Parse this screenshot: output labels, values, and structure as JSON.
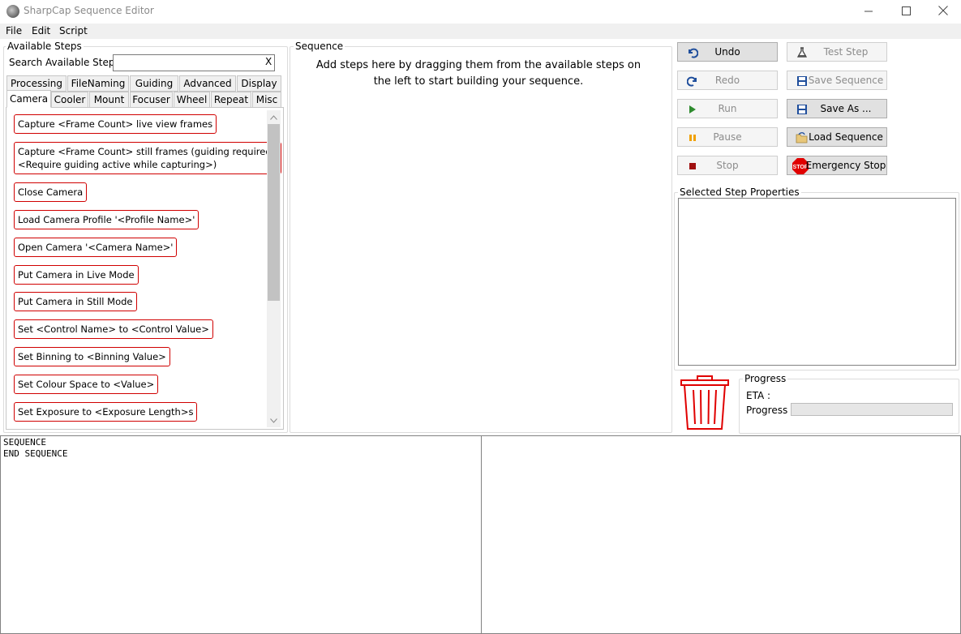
{
  "window": {
    "title": "SharpCap Sequence Editor",
    "minimize_glyph": "—",
    "maximize_glyph": "☐",
    "close_glyph": "✕"
  },
  "menu": [
    "File",
    "Edit",
    "Script"
  ],
  "available_steps": {
    "title": "Available Steps",
    "search_label": "Search Available Steps",
    "search_value": "",
    "search_clear": "X",
    "tabs_row1": [
      "Processing",
      "FileNaming",
      "Guiding",
      "Advanced",
      "Display"
    ],
    "tabs_row2": [
      "Camera",
      "Cooler",
      "Mount",
      "Focuser",
      "Wheel",
      "Repeat",
      "Misc"
    ],
    "active_tab": "Camera",
    "steps": [
      "Capture <Frame Count> live view frames",
      "Capture <Frame Count> still frames (guiding required :\n<Require guiding active while capturing>)",
      "Close Camera",
      "Load Camera Profile '<Profile Name>'",
      "Open Camera '<Camera Name>'",
      "Put Camera in Live Mode",
      "Put Camera in Still Mode",
      "Set <Control Name> to <Control Value>",
      "Set Binning to <Binning Value>",
      "Set Colour Space to <Value>",
      "Set Exposure to <Exposure Length>s"
    ]
  },
  "sequence": {
    "title": "Sequence",
    "hint_line1": "Add steps here by dragging them from the available steps on",
    "hint_line2": "the left to start building your sequence."
  },
  "buttons": {
    "undo": {
      "label": "Undo",
      "icon": "undo-icon"
    },
    "redo": {
      "label": "Redo",
      "icon": "redo-icon"
    },
    "run": {
      "label": "Run",
      "icon": "play-icon"
    },
    "pause": {
      "label": "Pause",
      "icon": "pause-icon"
    },
    "stop": {
      "label": "Stop",
      "icon": "stop-square-icon"
    },
    "test_step": {
      "label": "Test Step",
      "icon": "flask-icon"
    },
    "save_sequence": {
      "label": "Save Sequence",
      "icon": "floppy-icon"
    },
    "save_as": {
      "label": "Save As ...",
      "icon": "floppy-icon"
    },
    "load_sequence": {
      "label": "Load Sequence",
      "icon": "folder-open-icon"
    },
    "emergency_stop": {
      "label": "Emergency Stop",
      "icon": "stop-sign-icon",
      "icon_text": "STOP"
    }
  },
  "properties": {
    "title": "Selected Step Properties"
  },
  "progress": {
    "title": "Progress",
    "eta_label": "ETA :",
    "eta_value": "",
    "progress_label": "Progress :",
    "progress_fraction": 0
  },
  "trash": {
    "icon": "trash-icon"
  },
  "script_pane": {
    "text": "SEQUENCE\nEND SEQUENCE"
  },
  "colors": {
    "step_border": "#d00000",
    "trash_red": "#e00000",
    "run_green": "#2e8b2e",
    "pause_orange": "#f0a000",
    "stop_red": "#a01010",
    "undo_blue": "#1f4e9c"
  }
}
